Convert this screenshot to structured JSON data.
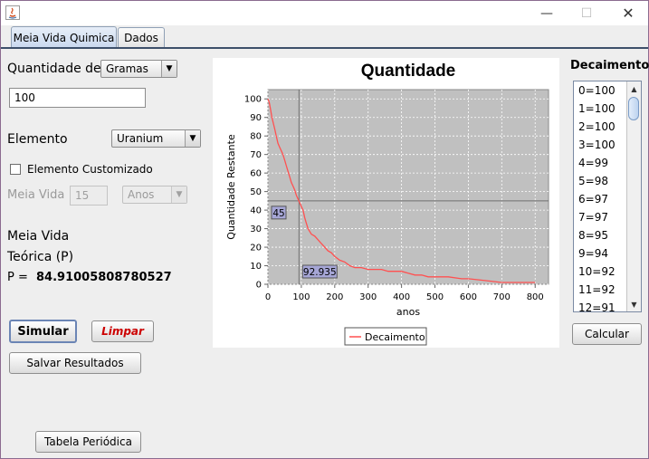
{
  "window": {
    "minimize_glyph": "—",
    "maximize_glyph": "☐",
    "close_glyph": "✕"
  },
  "tabs": [
    {
      "label": "Meia Vida Quimica",
      "active": true
    },
    {
      "label": "Dados",
      "active": false
    }
  ],
  "form": {
    "quantity_label": "Quantidade de",
    "quantity_unit": "Gramas",
    "quantity_value": "100",
    "element_label": "Elemento",
    "element_value": "Uranium",
    "custom_element_label": "Elemento Customizado",
    "custom_element_checked": false,
    "half_life_label": "Meia Vida",
    "half_life_value": "15",
    "half_life_unit": "Anos",
    "theoretical_label_1": "Meia Vida",
    "theoretical_label_2": "Teórica (P)",
    "p_label": "P =",
    "p_value": "84.91005808780527"
  },
  "buttons": {
    "simulate": "Simular",
    "clear": "Limpar",
    "save_results": "Salvar Resultados",
    "periodic_table": "Tabela Periódica",
    "calculate": "Calcular"
  },
  "decay_list": {
    "title": "Decaimento",
    "items": [
      "0=100",
      "1=100",
      "2=100",
      "3=100",
      "4=99",
      "5=98",
      "6=97",
      "7=97",
      "8=95",
      "9=94",
      "10=92",
      "11=92",
      "12=91"
    ]
  },
  "chart_data": {
    "type": "line",
    "title": "Quantidade",
    "xlabel": "anos",
    "ylabel": "Quantidade Restante",
    "xlim": [
      0,
      840
    ],
    "ylim": [
      0,
      105
    ],
    "xticks": [
      0,
      100,
      200,
      300,
      400,
      500,
      600,
      700,
      800
    ],
    "yticks": [
      0,
      10,
      20,
      30,
      40,
      50,
      60,
      70,
      80,
      90,
      100
    ],
    "grid": true,
    "legend_position": "bottom",
    "crosshair": {
      "x": 92.935,
      "y": 45,
      "x_label": "92.935",
      "y_label": "45"
    },
    "series": [
      {
        "name": "Decaimento",
        "color": "#ff5050",
        "x": [
          0,
          4,
          8,
          12,
          16,
          20,
          25,
          30,
          35,
          40,
          45,
          50,
          55,
          60,
          65,
          70,
          75,
          80,
          85,
          90,
          95,
          100,
          105,
          110,
          115,
          120,
          130,
          140,
          150,
          160,
          170,
          180,
          190,
          200,
          215,
          230,
          245,
          260,
          280,
          300,
          320,
          340,
          360,
          380,
          400,
          420,
          440,
          460,
          480,
          500,
          540,
          580,
          600,
          650,
          700,
          760,
          800
        ],
        "y": [
          100,
          98,
          94,
          90,
          87,
          84,
          80,
          76,
          74,
          72,
          70,
          67,
          64,
          61,
          58,
          55,
          53,
          51,
          48,
          46,
          44,
          42,
          40,
          36,
          33,
          30,
          27,
          26,
          24,
          22,
          20,
          18,
          17,
          15,
          13,
          12,
          10,
          9,
          9,
          8,
          8,
          8,
          7,
          7,
          7,
          6,
          5,
          5,
          4,
          4,
          4,
          3,
          3,
          2,
          1,
          1,
          1
        ]
      }
    ]
  }
}
